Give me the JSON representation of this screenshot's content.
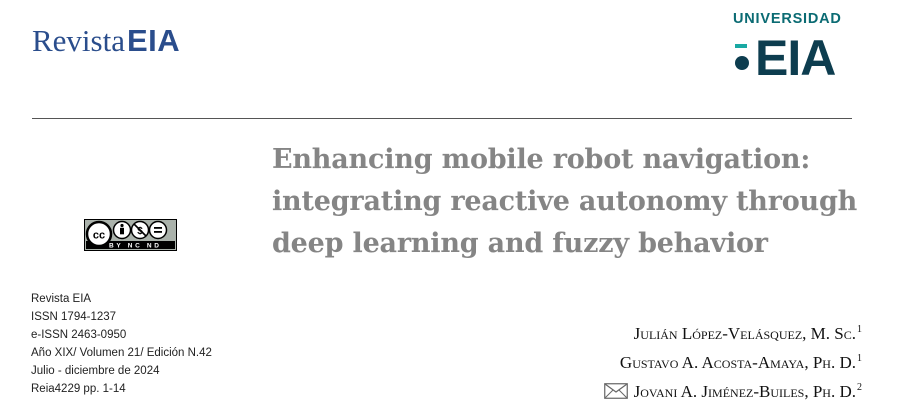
{
  "header": {
    "journal_logo": {
      "prefix": "Revista",
      "mark": "EIA"
    },
    "university_logo": {
      "top_word": "UNIVERSIDAD",
      "mark": "EIA"
    }
  },
  "title_lines": [
    "Enhancing mobile robot navigation:",
    "integrating reactive autonomy through",
    "deep learning and fuzzy behavior"
  ],
  "license": {
    "badge_text": "BY NC ND",
    "icon": "cc-by-nc-nd-icon"
  },
  "journal_info": [
    "Revista EIA",
    "ISSN 1794-1237",
    "e-ISSN 2463-0950",
    "Año XIX/ Volumen 21/ Edición N.42",
    "Julio - diciembre de 2024",
    "Reia4229 pp. 1-14"
  ],
  "authors": [
    {
      "name": "Julián López-Velásquez, M. Sc.",
      "affiliation": "1"
    },
    {
      "name": "Gustavo A. Acosta-Amaya, Ph. D.",
      "affiliation": "1"
    },
    {
      "name": "Jovani A. Jiménez-Builes, Ph. D.",
      "affiliation": "2",
      "icon": "envelope-icon"
    }
  ],
  "colors": {
    "journal_blue": "#2a4d8c",
    "university_teal": "#0b6b73",
    "university_dark": "#0d3d4f",
    "title_gray": "#858585"
  }
}
